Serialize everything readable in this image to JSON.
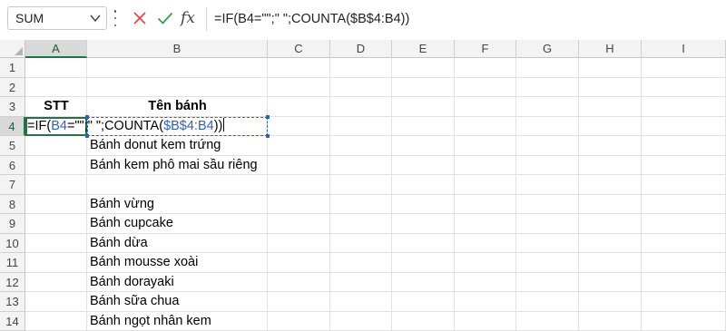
{
  "formula_bar": {
    "name_box": "SUM",
    "formula": "=IF(B4=\"\";\" \";COUNTA($B$4:B4))",
    "fx_label": "fx"
  },
  "columns": [
    "A",
    "B",
    "C",
    "D",
    "E",
    "F",
    "G",
    "H",
    "I"
  ],
  "rows": [
    "1",
    "2",
    "3",
    "4",
    "5",
    "6",
    "7",
    "8",
    "9",
    "10",
    "11",
    "12",
    "13",
    "14"
  ],
  "cells": {
    "A3": "STT",
    "B3": "Tên bánh",
    "A4_edit": {
      "part1": "=IF(",
      "ref1": "B4",
      "part2": "=\"\";\" \";COUNTA(",
      "ref2": "$B$4:B4",
      "part3": "))"
    },
    "B5": "Bánh donut kem trứng",
    "B6": "Bánh kem phô mai sầu riêng",
    "B8": "Bánh vừng",
    "B9": "Bánh cupcake",
    "B10": "Bánh dừa",
    "B11": "Bánh mousse xoài",
    "B12": "Bánh dorayaki",
    "B13": "Bánh sữa chua",
    "B14": "Bánh ngọt nhân kem"
  },
  "active_column": "A",
  "active_row": "4",
  "colors": {
    "selection": "#217346",
    "reference": "#2f62b5",
    "cancel_icon": "#e04848",
    "enter_icon": "#3a9a4a"
  },
  "icons": {
    "name_box_dropdown": "chevron-down-icon",
    "cancel": "cancel-x-icon",
    "enter": "enter-check-icon",
    "insert_function": "fx-icon"
  }
}
